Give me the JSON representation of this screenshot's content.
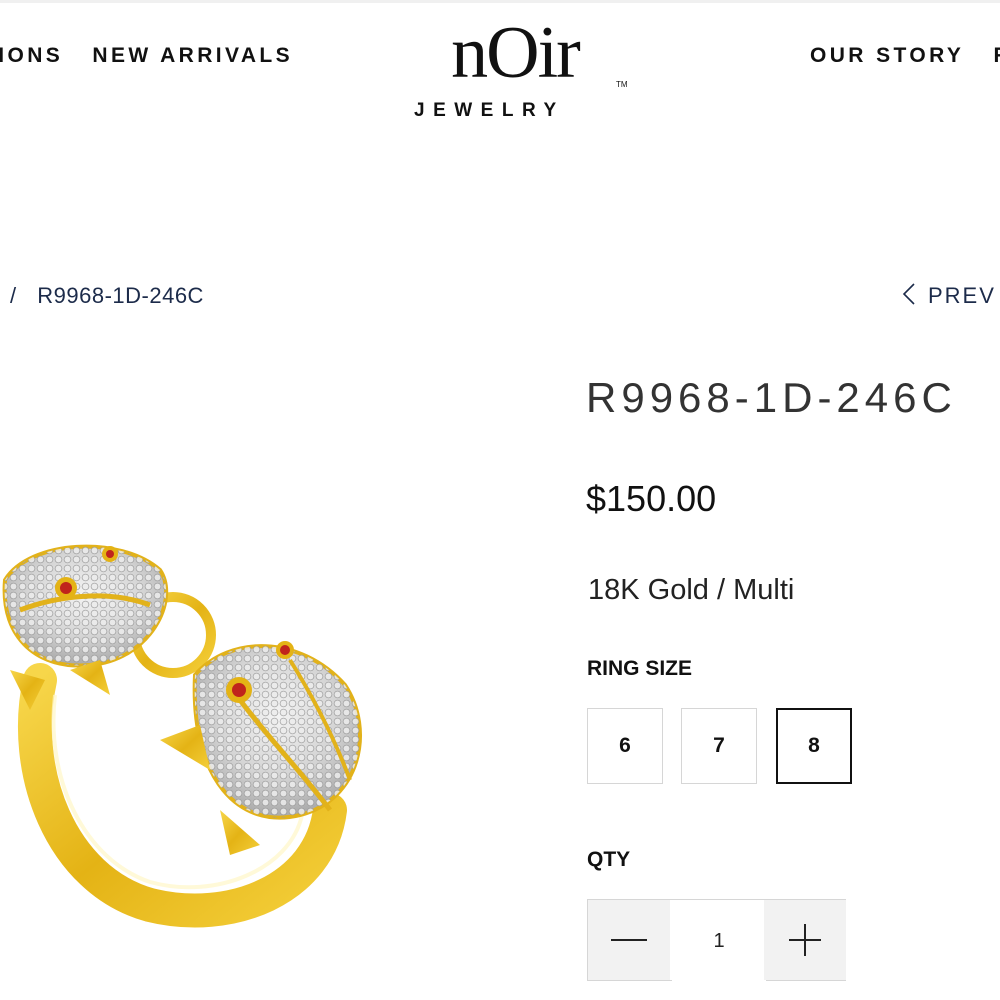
{
  "header": {
    "nav_left": [
      "TIONS",
      "NEW ARRIVALS"
    ],
    "nav_right": [
      "OUR STORY",
      "FA"
    ],
    "logo": {
      "word": "nOir",
      "tm": "TM",
      "subtitle": "JEWELRY"
    }
  },
  "breadcrumb": {
    "separator": "/",
    "current": "R9968-1D-246C"
  },
  "pager": {
    "prev_label": "PREV"
  },
  "product": {
    "title": "R9968-1D-246C",
    "price": "$150.00",
    "variant": "18K Gold / Multi",
    "ring_size_label": "RING SIZE",
    "ring_sizes": [
      "6",
      "7",
      "8"
    ],
    "selected_size": "8",
    "qty_label": "QTY",
    "qty_value": "1"
  },
  "icons": {
    "prev": "chevron-left-icon",
    "minus": "minus-icon",
    "plus": "plus-icon"
  },
  "colors": {
    "gold": "#e8b820",
    "gem_red": "#c0241c",
    "link": "#1c2b4a",
    "selected_border": "#111111"
  }
}
